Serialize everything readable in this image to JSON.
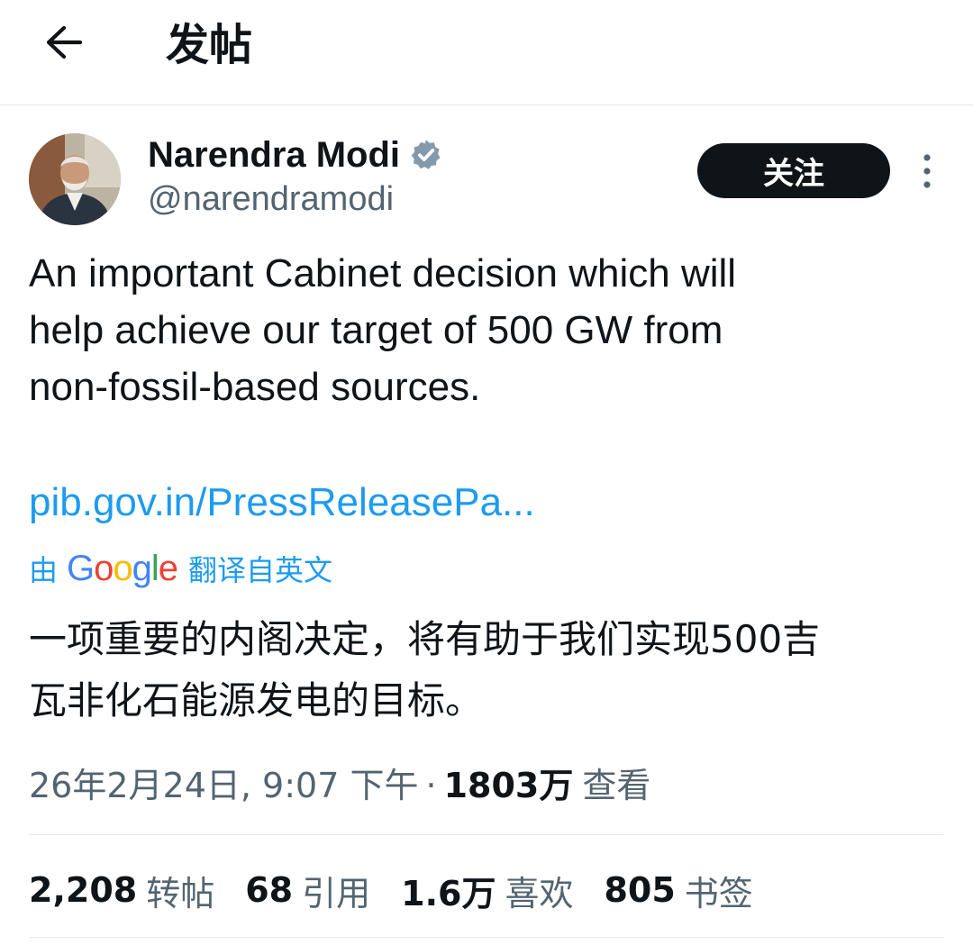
{
  "header": {
    "back_icon": "arrow-left-icon",
    "title": "发帖"
  },
  "author": {
    "name": "Narendra Modi",
    "handle": "@narendramodi",
    "verified_icon": "verified-badge-icon",
    "verified_color": "#829aab"
  },
  "follow_button": {
    "label": "关注"
  },
  "more_icon": "more-vertical-icon",
  "post": {
    "lines": [
      "An important Cabinet decision which will",
      "help achieve our target of 500 GW from",
      "non-fossil-based sources."
    ],
    "link": "pib.gov.in/PressReleasePa..."
  },
  "translation": {
    "prefix": "由",
    "provider": "Google",
    "suffix": "翻译自英文",
    "lines": [
      "一项重要的内阁决定，将有助于我们实现500吉",
      "瓦非化石能源发电的目标。"
    ]
  },
  "meta": {
    "timestamp": "26年2月24日, 9:07 下午",
    "separator": "·",
    "views_count": "1803万",
    "views_label": "查看"
  },
  "stats": [
    {
      "count": "2,208",
      "label": "转帖"
    },
    {
      "count": "68",
      "label": "引用"
    },
    {
      "count": "1.6万",
      "label": "喜欢"
    },
    {
      "count": "805",
      "label": "书签"
    }
  ],
  "colors": {
    "text": "#0f1419",
    "secondary": "#536471",
    "link": "#1d9bf0",
    "divider": "#e6e9eb",
    "google_blue": "#4285f4",
    "google_red": "#ea4335",
    "google_yellow": "#fbbc05",
    "google_green": "#34a853"
  }
}
